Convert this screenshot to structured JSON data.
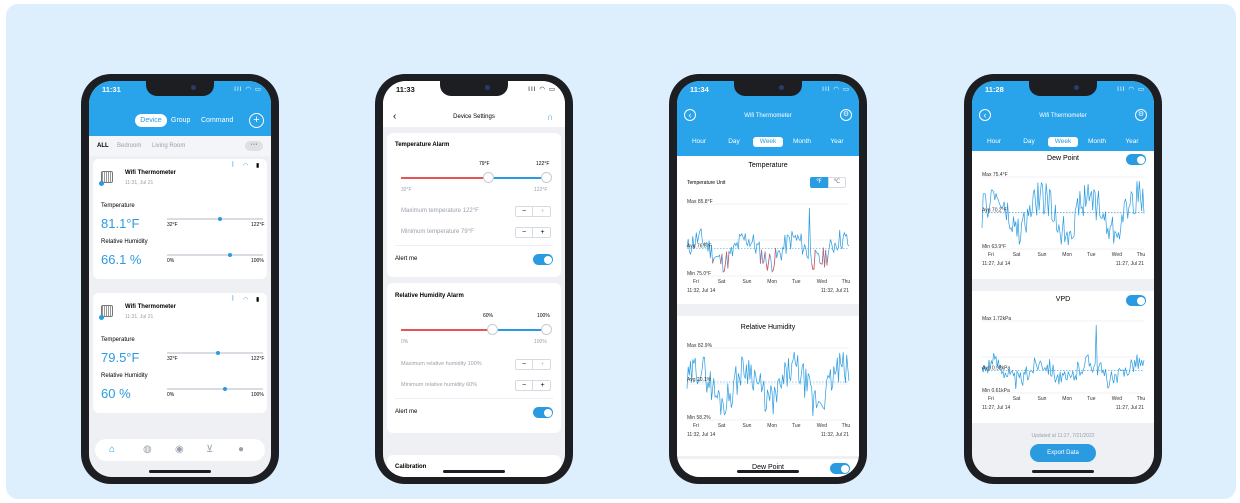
{
  "phone1": {
    "time": "11:31",
    "status_icons": "ΙΙΙ ◠ ▭",
    "tabs": [
      "Device",
      "Group",
      "Command"
    ],
    "add": "+",
    "rooms": [
      "ALL",
      "Bedroom",
      "Living Room"
    ],
    "more": "···",
    "devices": [
      {
        "name": "Wifi Thermometer",
        "time": "11:31,  Jul 21",
        "temp_label": "Temperature",
        "temp": "81.1°F",
        "tmin": "32°F",
        "tmax": "122°F",
        "hum_label": "Relative Humidity",
        "hum": "66.1 %",
        "hmin": "0%",
        "hmax": "100%",
        "temp_level": 0.55,
        "hum_level": 0.66
      },
      {
        "name": "Wifi Thermometer",
        "time": "11:31,  Jul 21",
        "temp_label": "Temperature",
        "temp": "79.5°F",
        "tmin": "32°F",
        "tmax": "122°F",
        "hum_label": "Relative Humidity",
        "hum": "60 %",
        "hmin": "0%",
        "hmax": "100%",
        "temp_level": 0.53,
        "hum_level": 0.6
      }
    ],
    "nav_icons": [
      "home-icon",
      "globe-icon",
      "compass-icon",
      "cart-icon",
      "person-icon"
    ]
  },
  "phone2": {
    "time": "11:33",
    "title": "Device Settings",
    "temp_alarm": {
      "title": "Temperature Alarm",
      "low": "79°F",
      "high": "122°F",
      "min_label": "32°F",
      "max_label": "122°F",
      "max_text": "Maximum temperature  122°F",
      "min_text": "Minimum temperature  79°F",
      "alert": "Alert me"
    },
    "hum_alarm": {
      "title": "Relative Humidity Alarm",
      "low": "60%",
      "high": "100%",
      "min_label": "0%",
      "max_label": "100%",
      "max_text": "Maximum relative humidity  100%",
      "min_text": "Minimum relative humidity  60%",
      "alert": "Alert me"
    },
    "calibration": "Calibration",
    "minus": "−",
    "plus": "+"
  },
  "phone3": {
    "time": "11:34",
    "title": "Wifi Thermometer",
    "ranges": [
      "Hour",
      "Day",
      "Week",
      "Month",
      "Year"
    ],
    "selected_range": "Week",
    "unit_label": "Temperature Unit",
    "unit_f": "℉",
    "unit_c": "℃",
    "temp_chart": {
      "title": "Temperature",
      "max": "Max 85.8°F",
      "avg": "Avg 76.6°F",
      "min": "Min 75.0°F",
      "days": [
        "Fri",
        "Sat",
        "Sun",
        "Mon",
        "Tue",
        "Wed",
        "Thu"
      ],
      "start": "11:32,  Jul 14",
      "end": "11:32,  Jul 21"
    },
    "hum_chart": {
      "title": "Relative Humidity",
      "max": "Max 82.9%",
      "avg": "Avg 20.1%",
      "min": "Min 58.2%",
      "days": [
        "Fri",
        "Sat",
        "Sun",
        "Mon",
        "Tue",
        "Wed",
        "Thu"
      ],
      "start": "11:32,  Jul 14",
      "end": "11:32,  Jul 21"
    },
    "dew_title": "Dew Point"
  },
  "phone4": {
    "time": "11:28",
    "title": "Wifi Thermometer",
    "ranges": [
      "Hour",
      "Day",
      "Week",
      "Month",
      "Year"
    ],
    "selected_range": "Week",
    "dew_chart": {
      "title": "Dew Point",
      "max": "Max 75.4°F",
      "avg": "Avg 70.2°F",
      "min": "Min 63.9°F",
      "days": [
        "Fri",
        "Sat",
        "Sun",
        "Mon",
        "Tue",
        "Wed",
        "Thu"
      ],
      "start": "11:27,  Jul 14",
      "end": "11:27,  Jul 21"
    },
    "vpd_chart": {
      "title": "VPD",
      "max": "Max 1.72kPa",
      "avg": "Avg 0.92kPa",
      "min": "Min 0.61kPa",
      "days": [
        "Fri",
        "Sat",
        "Sun",
        "Mon",
        "Tue",
        "Wed",
        "Thu"
      ],
      "start": "11:27,  Jul 14",
      "end": "11:27,  Jul 21"
    },
    "updated": "Updated at 11:27,  7/21/2022",
    "export": "Export Data"
  },
  "colors": {
    "accent": "#2a9be0",
    "alarm_red": "#e4555a",
    "panel": "#ddeefd"
  }
}
